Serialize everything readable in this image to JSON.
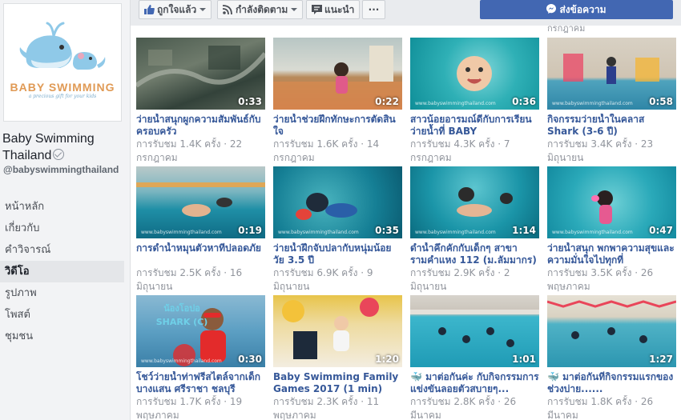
{
  "page": {
    "name": "Baby Swimming Thailand",
    "handle": "@babyswimmingthailand",
    "logo": {
      "brand_text": "BABY SWIMMING",
      "tagline": "a precious gift for your kids"
    }
  },
  "nav": [
    {
      "label": "หน้าหลัก"
    },
    {
      "label": "เกี่ยวกับ"
    },
    {
      "label": "คำวิจารณ์"
    },
    {
      "label": "วิดีโอ",
      "active": true
    },
    {
      "label": "รูปภาพ"
    },
    {
      "label": "โพสต์"
    },
    {
      "label": "ชุมชน"
    }
  ],
  "topbar": {
    "like_label": "ถูกใจแล้ว",
    "follow_label": "กำลังติดตาม",
    "recommend_label": "แนะนำ",
    "more_label": "···",
    "message_label": "ส่งข้อความ"
  },
  "cutoff_text": "กรกฎาคม",
  "watermark": "www.babyswimmingthailand.com",
  "videos": [
    {
      "title": "ว่ายน้ำสนุกผูกความสัมพันธ์กับครอบครัว",
      "meta": "การรับชม 1.4K ครั้ง · 22 กรกฎาคม",
      "duration": "0:33"
    },
    {
      "title": "ว่ายน้ำช่วยฝึกทักษะการตัดสินใจ",
      "meta": "การรับชม 1.6K ครั้ง · 14 กรกฎาคม",
      "duration": "0:22"
    },
    {
      "title": "สาวน้อยอารมณ์ดีกับการเรียนว่ายน้ำที่ BABY SWIMMING",
      "meta": "การรับชม 4.3K ครั้ง · 7 กรกฎาคม",
      "duration": "0:36"
    },
    {
      "title": "กิจกรรมว่ายน้ำในคลาส Shark (3-6 ปี)",
      "meta": "การรับชม 3.4K ครั้ง · 23 มิถุนายน",
      "duration": "0:58"
    },
    {
      "title": "การดำน้ำหมุนตัวหาทีปลอดภัย",
      "meta": "การรับชม 2.5K ครั้ง · 16 มิถุนายน",
      "duration": "0:19"
    },
    {
      "title": "ว่ายน้ำฝึกจับปลากับหนุ่มน้อยวัย 3.5 ปี",
      "meta": "การรับชม 6.9K ครั้ง · 9 มิถุนายน",
      "duration": "0:35"
    },
    {
      "title": "ดำน้ำคึกคักกับเด็กๆ สาขารามคำแหง 112 (ม.ลัมมากร)",
      "meta": "การรับชม 2.9K ครั้ง · 2 มิถุนายน",
      "duration": "1:14"
    },
    {
      "title": "ว่ายน้ำสนุก พกพาความสุขและความมั่นใจไปทุกที่",
      "meta": "การรับชม 3.5K ครั้ง · 26 พฤษภาคม",
      "duration": "0:47"
    },
    {
      "title": "โชว์ว่ายน้ำท่าฟรีสไตล์จากเด็กบางแสน ศรีราชา ชลบุรี",
      "meta": "การรับชม 1.7K ครั้ง · 19 พฤษภาคม",
      "duration": "0:30",
      "overlay": "น้องโอปอ SHARK (C)"
    },
    {
      "title": "Baby Swimming Family Games 2017 (1 min)",
      "meta": "การรับชม 2.3K ครั้ง · 11 พฤษภาคม",
      "duration": "1:20"
    },
    {
      "title": "🐳 มาต่อกันค่ะ กับกิจกรรมการแข่งขันลอยตัวสบายๆ...",
      "meta": "การรับชม 2.8K ครั้ง · 26 มีนาคม",
      "duration": "1:01"
    },
    {
      "title": "🐳 มาต่อกันที่กิจกรรมแรกของช่วงบ่าย......",
      "meta": "การรับชม 1.8K ครั้ง · 26 มีนาคม",
      "duration": "1:27"
    }
  ]
}
